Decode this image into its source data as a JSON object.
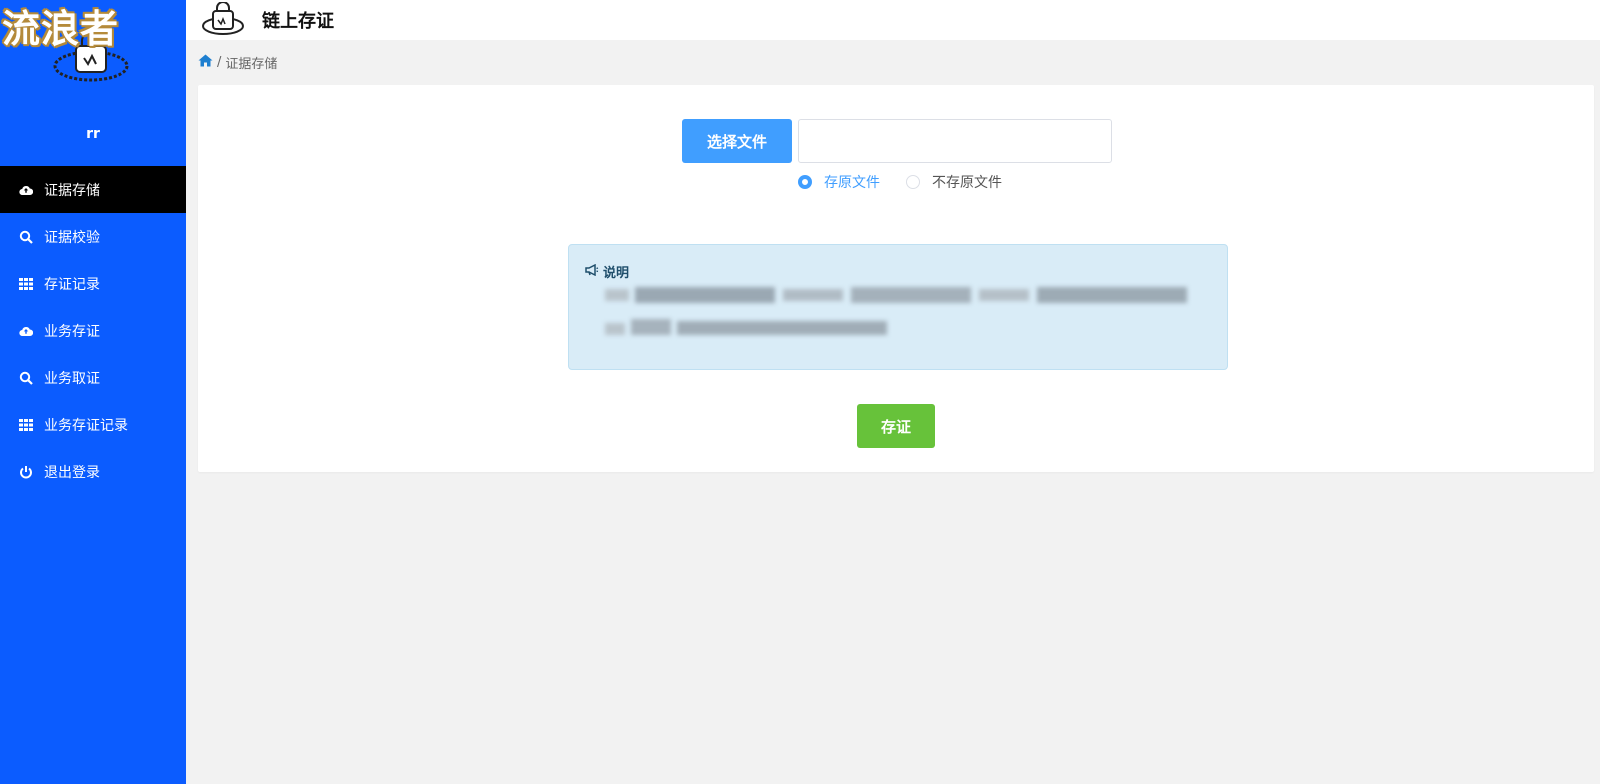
{
  "watermark": "流浪者",
  "sidebar": {
    "user_name": "rr",
    "items": [
      {
        "label": "证据存储",
        "icon": "cloud-upload-icon",
        "active": true
      },
      {
        "label": "证据校验",
        "icon": "search-icon",
        "active": false
      },
      {
        "label": "存证记录",
        "icon": "grid-icon",
        "active": false
      },
      {
        "label": "业务存证",
        "icon": "cloud-upload-icon",
        "active": false
      },
      {
        "label": "业务取证",
        "icon": "search-icon",
        "active": false
      },
      {
        "label": "业务存证记录",
        "icon": "grid-icon",
        "active": false
      },
      {
        "label": "退出登录",
        "icon": "power-icon",
        "active": false
      }
    ]
  },
  "header": {
    "title": "链上存证"
  },
  "breadcrumb": {
    "separator": "/",
    "current": "证据存储"
  },
  "upload": {
    "choose_label": "选择文件",
    "file_value": ""
  },
  "radios": [
    {
      "label": "存原文件",
      "checked": true
    },
    {
      "label": "不存原文件",
      "checked": false
    }
  ],
  "notice": {
    "title": "说明",
    "line1": "",
    "line2": ""
  },
  "actions": {
    "save_label": "存证"
  },
  "colors": {
    "sidebar": "#0b5cff",
    "primary": "#409eff",
    "success": "#67c23a",
    "notice_bg": "#d9ecf7"
  }
}
